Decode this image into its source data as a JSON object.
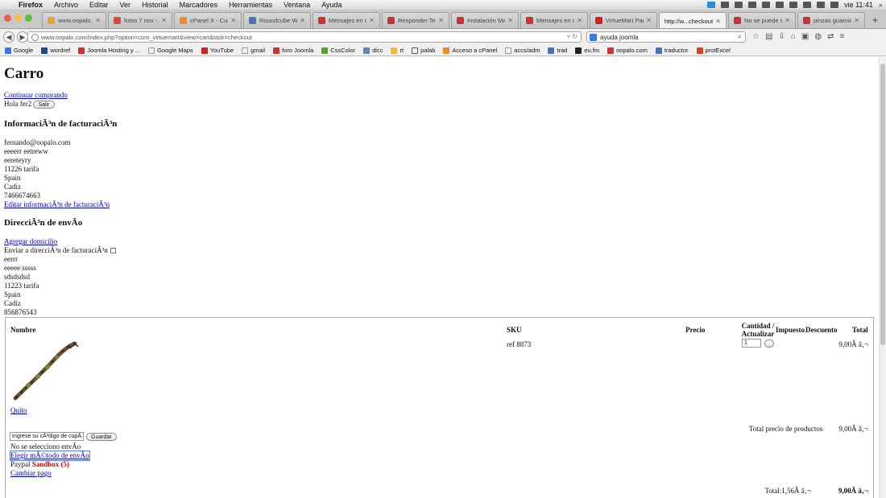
{
  "menubar": {
    "app": "Firefox",
    "items": [
      "Archivo",
      "Editar",
      "Ver",
      "Historial",
      "Marcadores",
      "Herramientas",
      "Ventana",
      "Ayuda"
    ],
    "clock": "vie 11:41"
  },
  "tabs": [
    {
      "title": "www.oopalo.c..."
    },
    {
      "title": "fotos 7 nov -..."
    },
    {
      "title": "cPanel X - Cue..."
    },
    {
      "title": "Roundcube We..."
    },
    {
      "title": "Mensajes en c..."
    },
    {
      "title": "Responder Te..."
    },
    {
      "title": "Instalación Ma..."
    },
    {
      "title": "Mensajes en c..."
    },
    {
      "title": "VirtueMart Par..."
    },
    {
      "title": "http://w...checkout"
    },
    {
      "title": "No se puede s..."
    },
    {
      "title": "pinzas guarnic..."
    }
  ],
  "colors": {
    "accent": "#0000cc",
    "sandbox": "#dd0000"
  },
  "nav": {
    "url": "www.oopalo.com/index.php?option=com_virtuemart&view=cart&task=checkout",
    "search": "ayuda joomla"
  },
  "bookmarks": [
    "Google",
    "wordref",
    "Joomla Hosting y ...",
    "Google Maps",
    "YouTube",
    "gmail",
    "foro Joomla",
    "CssColor",
    "dicc",
    "rt",
    "palab",
    "Acceso a cPanel",
    "accs/adm",
    "trad",
    "eu.fm",
    "oopalo.com",
    "traductor",
    "protExcel"
  ],
  "page": {
    "title": "Carro",
    "continue_link": "Continuar comprando",
    "greeting": "Hola fer2",
    "logout": "Salir",
    "billing": {
      "heading": "InformaciÃ³n de facturaciÃ³n",
      "lines": [
        "fernando@oopalo.com",
        "eeeerr eetreww",
        "eereteyry",
        "11226 tarifa",
        "Spain",
        "Cadiz",
        "7466674663"
      ],
      "edit_link": "Editar informaciÃ³n de facturaciÃ³n"
    },
    "shipping": {
      "heading": "DirecciÃ³n de envÃ­o",
      "add_link": "Agregar domicilio",
      "same_as_billing": "Enviar a direcciÃ³n de facturaciÃ³n",
      "lines": [
        "eerrr",
        "eeeee sssss",
        "sdsdsdsd",
        "11223 tarifa",
        "Spain",
        "Cadiz",
        "856876543"
      ]
    },
    "cart": {
      "headers": {
        "name": "Nombre",
        "sku": "SKU",
        "price": "Precio",
        "qty": "Cantidad / Actualizar",
        "tax": "Impuesto",
        "discount": "Descuento",
        "total": "Total"
      },
      "item": {
        "sku": "ref 8873",
        "qty": "1",
        "total": "9,00Â â‚¬",
        "remove": "Quito"
      },
      "coupon_placeholder": "Ingrese su cÃ³digo de cupÃ",
      "coupon_button": "Guardar",
      "products_total_label": "Total precio de productos",
      "products_total": "9,00Â â‚¬",
      "no_shipping": "No se selecciono envÃ­o",
      "choose_shipping": "Elegir mÃ©todo de envÃ­o",
      "payment": "Paypal",
      "sandbox": "Sandbox (5)",
      "change_payment": "Cambiar pago",
      "grand_total_label": "Total:1,56Â â‚¬",
      "grand_total": "9,00Â â‚¬"
    }
  }
}
